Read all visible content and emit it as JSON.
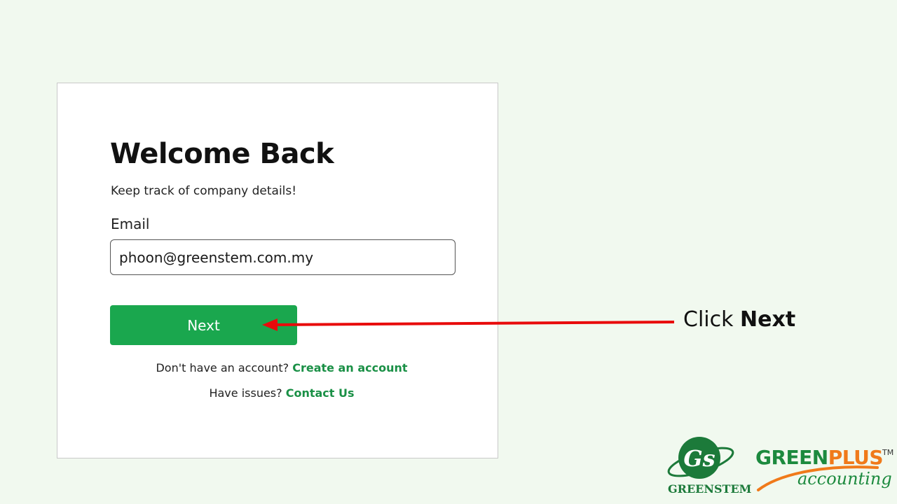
{
  "login_card": {
    "title": "Welcome Back",
    "subtitle": "Keep track of company details!",
    "email_label": "Email",
    "email_value": "phoon@greenstem.com.my",
    "next_label": "Next",
    "no_account_text": "Don't have an account?",
    "create_account_link": "Create an account",
    "issues_text": "Have issues?",
    "contact_link": "Contact Us"
  },
  "annotation": {
    "prefix": "Click",
    "target": "Next",
    "arrow_color": "#e80b0b"
  },
  "branding": {
    "greenstem_monogram": "Gs",
    "greenstem_name": "GREENSTEM",
    "greenplus_part1": "GREEN",
    "greenplus_part2": "PLUS",
    "greenplus_tm": "TM",
    "greenplus_sub": "accounting"
  },
  "colors": {
    "background": "#f1f9ef",
    "primary_button": "#1aa74e",
    "link_green": "#1a9046",
    "brand_orange": "#f07a1a"
  }
}
